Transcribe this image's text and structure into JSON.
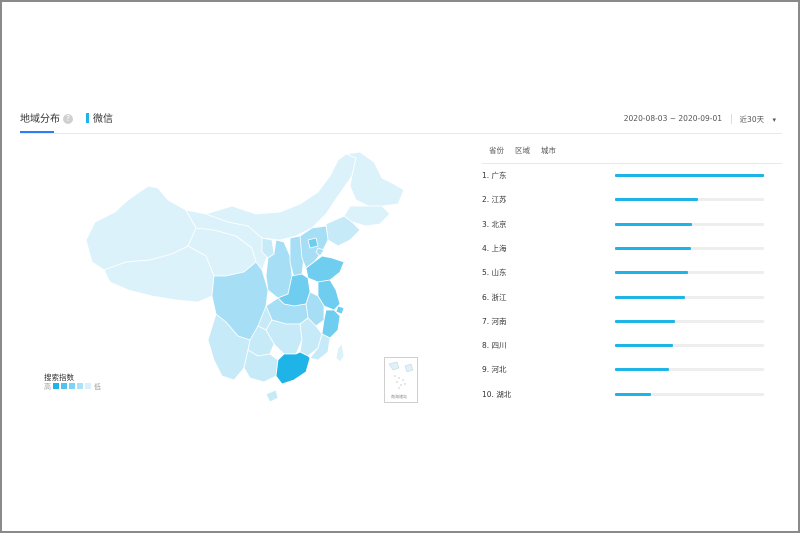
{
  "header": {
    "tab_region": "地域分布",
    "help_icon": "?",
    "tab_wechat": "微信",
    "date_range": "2020-08-03 ~ 2020-09-01",
    "period": "近30天",
    "dropdown_icon": "▾"
  },
  "legend": {
    "title": "搜索指数",
    "high": "高",
    "low": "低",
    "colors": [
      "#1fb4e8",
      "#4fc4ee",
      "#7dd3f3",
      "#ace2f7",
      "#daf1fb"
    ]
  },
  "map": {
    "inset_label": "南海诸岛",
    "colors": {
      "top": "#1fb4e8",
      "high": "#6fcdf0",
      "mid": "#a5def5",
      "low": "#c7eaf8",
      "lowest": "#dcf2fb"
    }
  },
  "ranking": {
    "tabs": [
      "省份",
      "区域",
      "城市"
    ],
    "items": [
      {
        "label": "1.   广东",
        "value": 100
      },
      {
        "label": "2.   江苏",
        "value": 56
      },
      {
        "label": "3.   北京",
        "value": 52
      },
      {
        "label": "4.   上海",
        "value": 51
      },
      {
        "label": "5.   山东",
        "value": 49
      },
      {
        "label": "6.   浙江",
        "value": 47
      },
      {
        "label": "7.   河南",
        "value": 40
      },
      {
        "label": "8.   四川",
        "value": 39
      },
      {
        "label": "9.   河北",
        "value": 36
      },
      {
        "label": "10.  湖北",
        "value": 24
      }
    ]
  }
}
